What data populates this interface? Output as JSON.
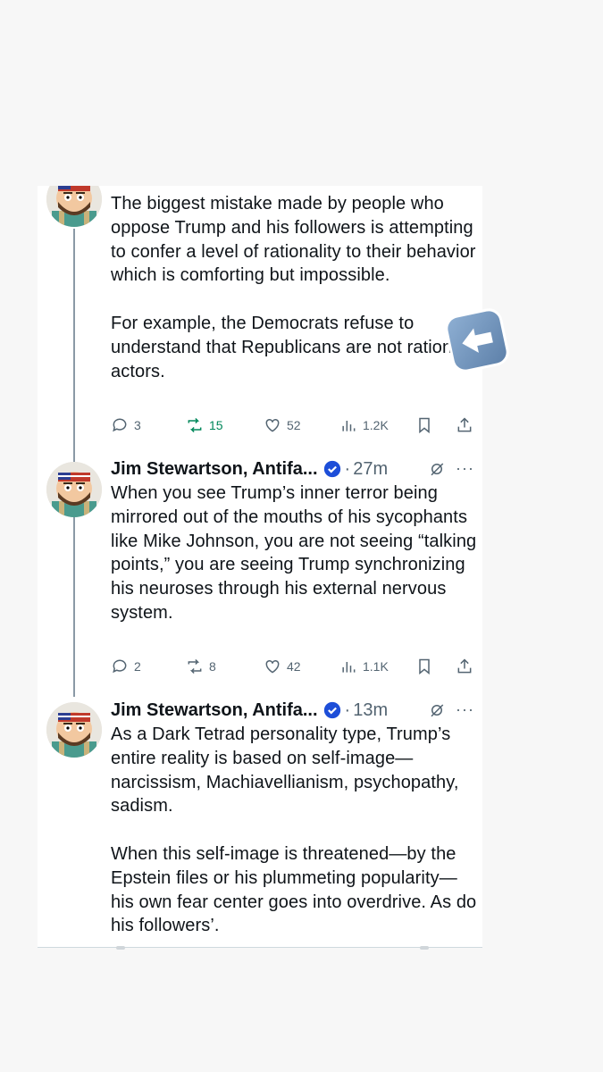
{
  "tweets": [
    {
      "text": "The biggest mistake made by people who oppose Trump and his followers is attempting to confer a level of rationality to their behavior which is comforting but impossible.\n\nFor example, the Democrats refuse to understand that Republicans are not rational actors.",
      "stats": {
        "replies": "3",
        "reposts": "15",
        "likes": "52",
        "views": "1.2K"
      }
    },
    {
      "author": "Jim Stewartson, Antifa...",
      "time": "27m",
      "text": "When you see Trump’s inner terror being mirrored out of the mouths of his sycophants like Mike Johnson, you are not seeing “talking points,” you are seeing Trump synchronizing his neuroses through his external nervous system.",
      "stats": {
        "replies": "2",
        "reposts": "8",
        "likes": "42",
        "views": "1.1K"
      }
    },
    {
      "author": "Jim Stewartson, Antifa...",
      "time": "13m",
      "text": "As a Dark Tetrad personality type, Trump’s entire reality is based on self-image—narcissism, Machiavellianism, psychopathy, sadism.\n\nWhen this self-image is threatened—by the Epstein files or his plummeting popularity—his own fear center goes into overdrive. As do his followers’."
    }
  ],
  "header_separator": "·",
  "more_glyph": "···",
  "colors": {
    "text": "#0f1419",
    "muted": "#536471",
    "verified": "#1d4ed8",
    "repost_active": "#00875a",
    "thread_line": "#8a99a6",
    "arrow_sticker": "#7093bb"
  },
  "icons": [
    "reply-icon",
    "repost-icon",
    "like-icon",
    "views-icon",
    "bookmark-icon",
    "share-icon",
    "verified-badge-icon",
    "grok-icon",
    "more-icon",
    "left-arrow-sticker"
  ]
}
